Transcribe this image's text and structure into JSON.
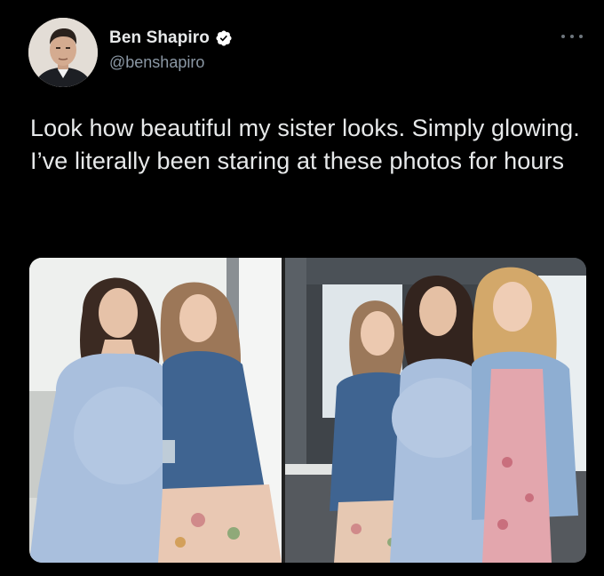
{
  "author": {
    "display_name": "Ben Shapiro",
    "handle": "@benshapiro",
    "verified": true,
    "avatar_icon": "profile-photo"
  },
  "menu_icon": "more-horizontal-icon",
  "tweet": {
    "text": "Look how beautiful my sister looks. Simply glowing. I’ve literally been staring at these photos for hours"
  },
  "media": [
    {
      "name": "photo-two-women"
    },
    {
      "name": "photo-three-women"
    }
  ],
  "colors": {
    "background": "#000000",
    "text": "#e7e9ea",
    "secondary_text": "#8b98a5",
    "verified_badge": "#ffffff"
  }
}
